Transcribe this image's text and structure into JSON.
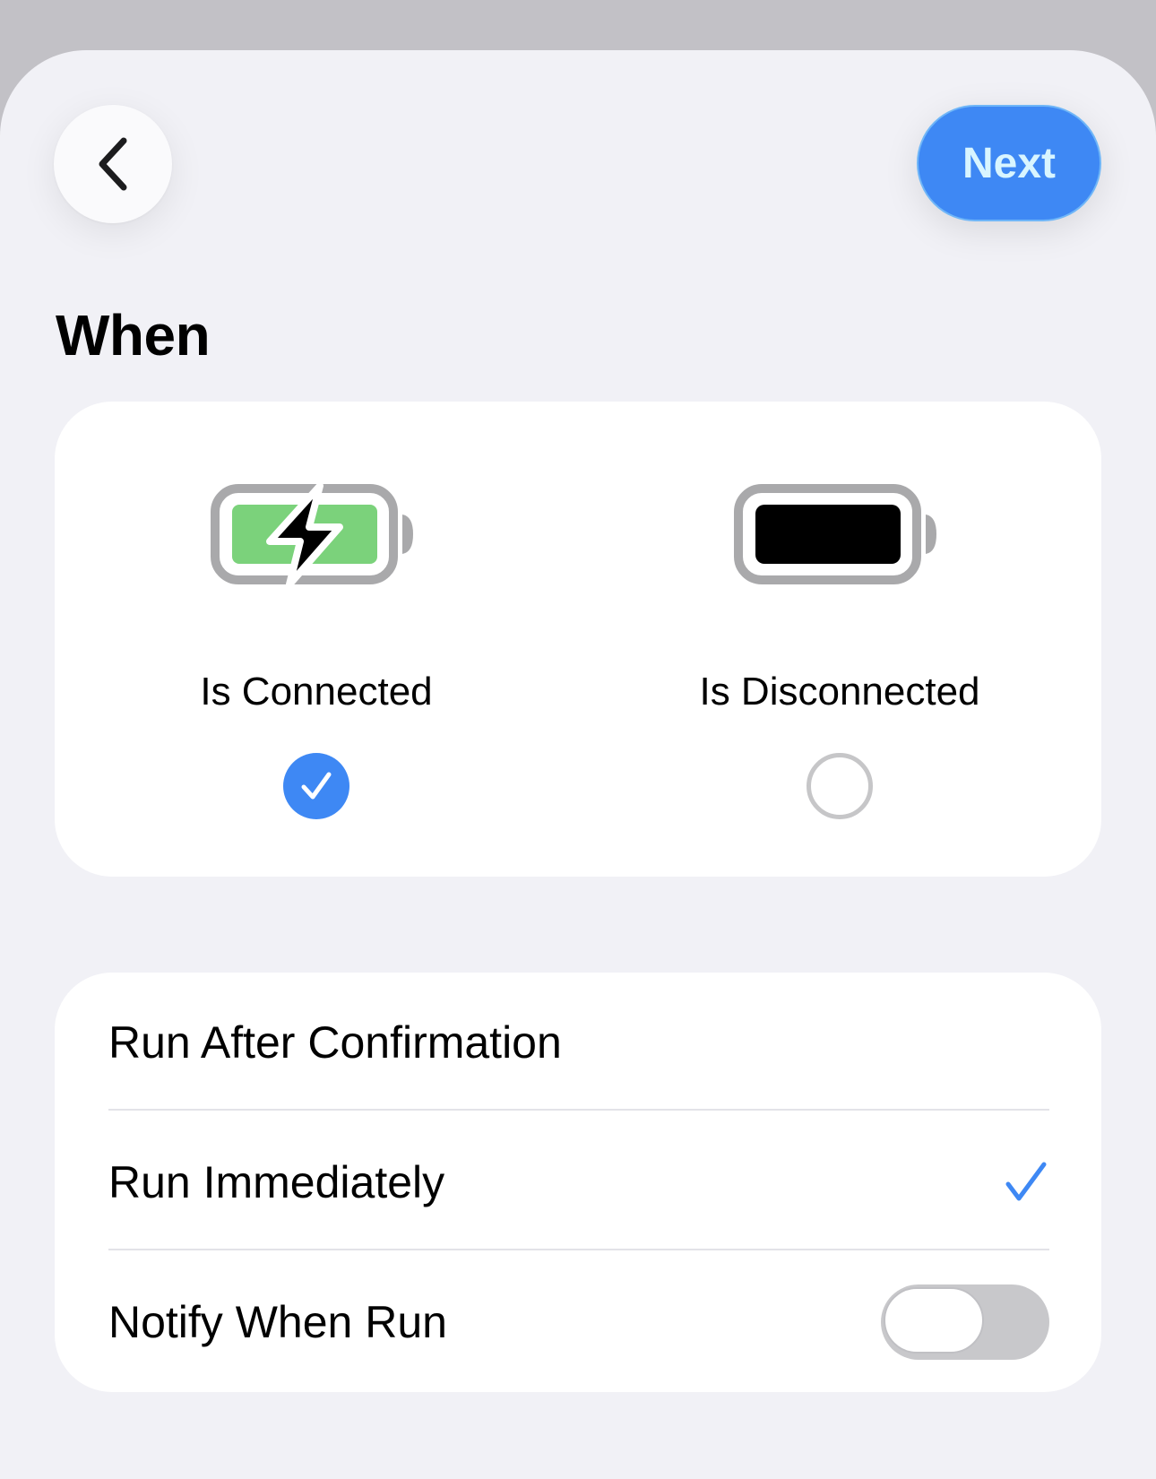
{
  "header": {
    "back_icon": "chevron-left-icon",
    "next_label": "Next"
  },
  "title": "When",
  "trigger_options": [
    {
      "label": "Is Connected",
      "icon": "battery-charging-icon",
      "selected": true
    },
    {
      "label": "Is Disconnected",
      "icon": "battery-full-icon",
      "selected": false
    }
  ],
  "run_options": {
    "items": [
      {
        "label": "Run After Confirmation",
        "selected": false
      },
      {
        "label": "Run Immediately",
        "selected": true
      }
    ],
    "notify": {
      "label": "Notify When Run",
      "enabled": false
    }
  },
  "colors": {
    "accent": "#3e88f4",
    "battery_green": "#7bd27b",
    "battery_gray": "#a9a9ab",
    "background": "#f1f1f6",
    "card": "#ffffff"
  }
}
